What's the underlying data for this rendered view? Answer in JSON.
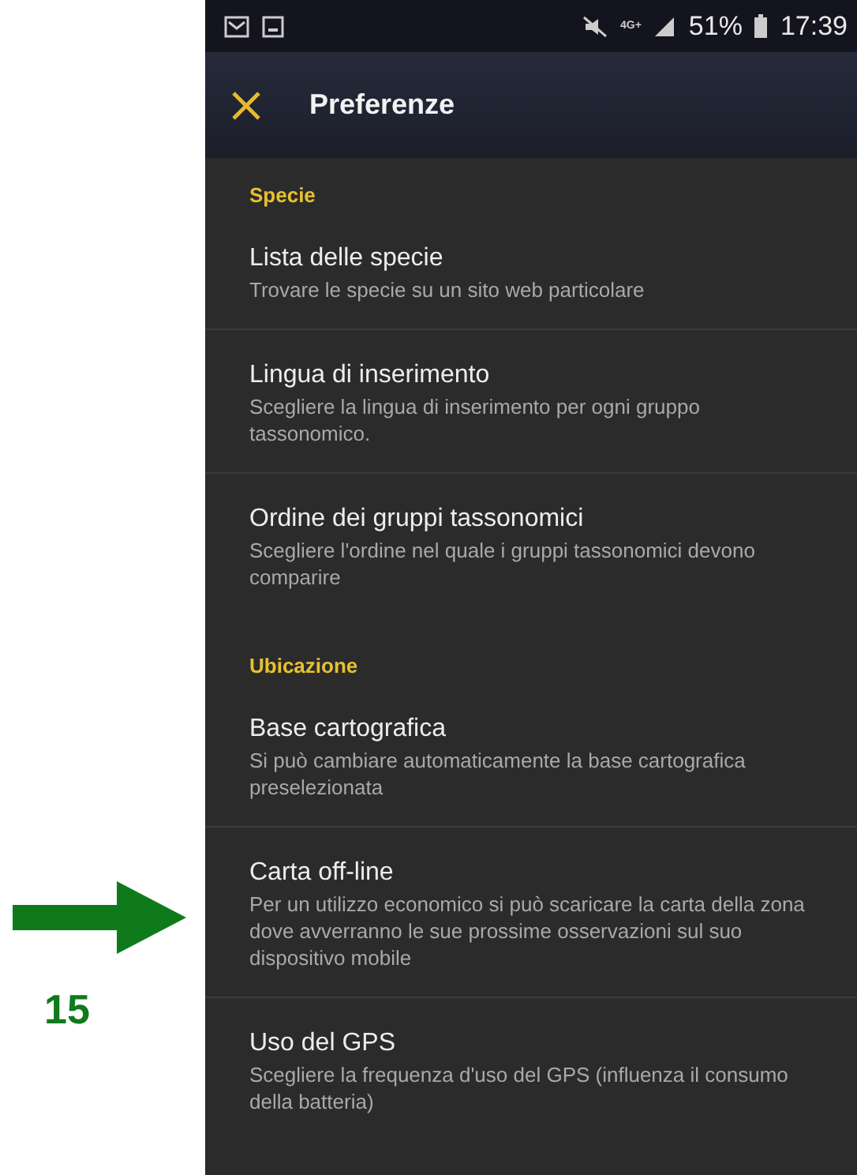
{
  "annotation": {
    "number": "15"
  },
  "status_bar": {
    "network": "4G+",
    "battery": "51%",
    "time": "17:39"
  },
  "app_bar": {
    "title": "Preferenze"
  },
  "sections": [
    {
      "header": "Specie",
      "items": [
        {
          "title": "Lista delle specie",
          "summary": "Trovare le specie su un sito web particolare"
        },
        {
          "title": "Lingua di inserimento",
          "summary": "Scegliere la lingua di inserimento per ogni gruppo tassonomico."
        },
        {
          "title": "Ordine dei gruppi tassonomici",
          "summary": "Scegliere l'ordine nel quale i gruppi tassonomici devono comparire"
        }
      ]
    },
    {
      "header": "Ubicazione",
      "items": [
        {
          "title": "Base cartografica",
          "summary": "Si può cambiare automaticamente la base cartografica preselezionata"
        },
        {
          "title": "Carta off-line",
          "summary": "Per un utilizzo economico si può scaricare la carta della zona dove avverranno le sue prossime osservazioni sul suo dispositivo mobile"
        },
        {
          "title": "Uso del GPS",
          "summary": "Scegliere la frequenza d'uso del GPS (influenza il consumo della batteria)"
        }
      ]
    }
  ]
}
